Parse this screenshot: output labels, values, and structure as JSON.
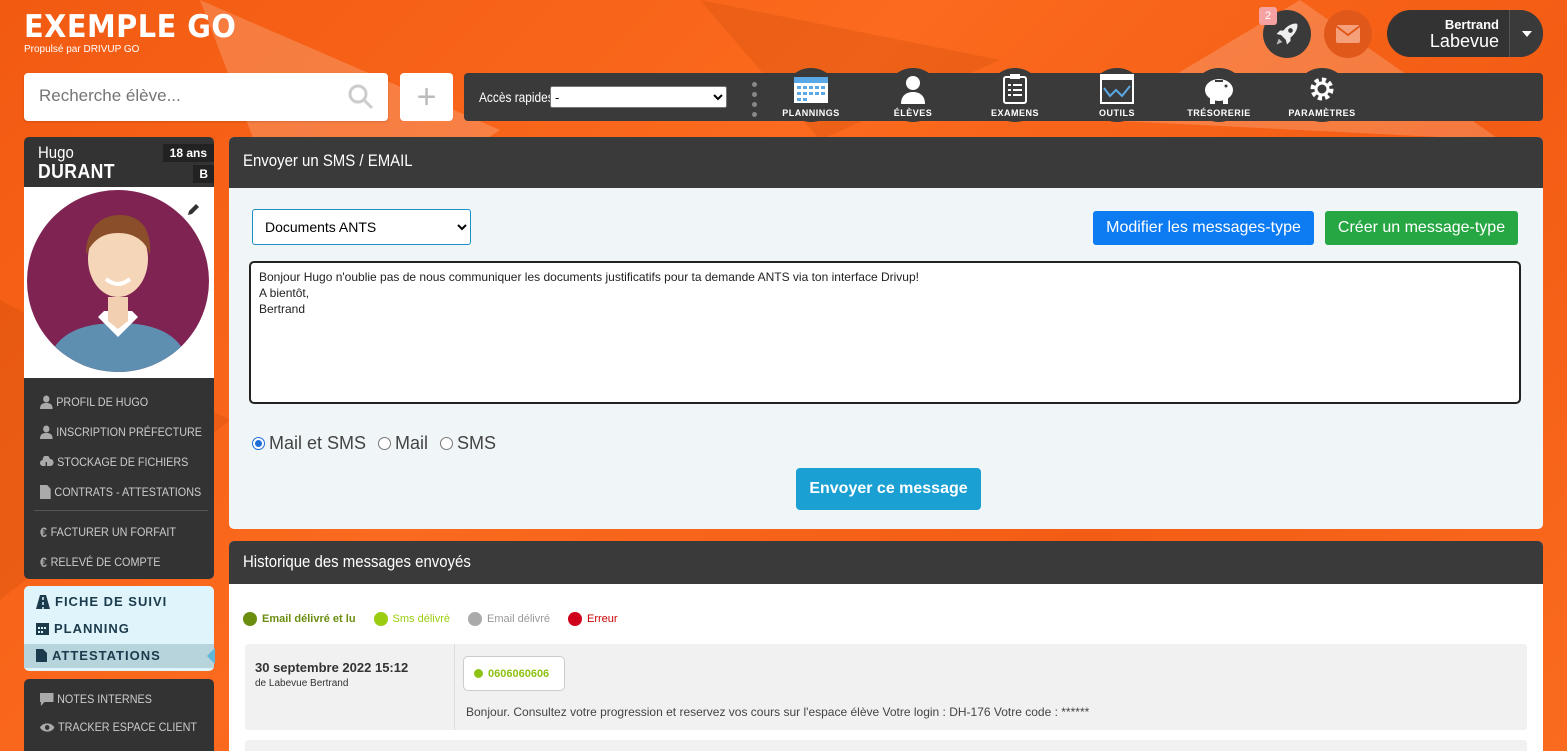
{
  "brand": {
    "title": "EXEMPLE GO",
    "subtitle": "Propulsé par DRIVUP GO"
  },
  "notifications": {
    "count": "2"
  },
  "user": {
    "first_name": "Bertrand",
    "last_name": "Labevue"
  },
  "search": {
    "placeholder": "Recherche élève..."
  },
  "quick_access": {
    "label": "Accès rapides",
    "selected": "-"
  },
  "nav": [
    {
      "label": "PLANNINGS",
      "icon": "calendar-icon"
    },
    {
      "label": "ÉLÈVES",
      "icon": "user-icon"
    },
    {
      "label": "EXAMENS",
      "icon": "clipboard-icon"
    },
    {
      "label": "OUTILS",
      "icon": "chart-icon"
    },
    {
      "label": "TRÉSORERIE",
      "icon": "piggy-bank-icon"
    },
    {
      "label": "PARAMÈTRES",
      "icon": "gear-icon"
    }
  ],
  "student": {
    "first_name": "Hugo",
    "last_name": "DURANT",
    "age": "18 ans",
    "category": "B"
  },
  "menu1": [
    {
      "label": "Profil de Hugo",
      "icon": "user-icon"
    },
    {
      "label": "Inscription préfecture",
      "icon": "user-icon"
    },
    {
      "label": "Stockage de fichiers",
      "icon": "cloud-icon"
    },
    {
      "label": "Contrats - Attestations",
      "icon": "file-icon"
    },
    {
      "label": "Facturer un forfait",
      "icon": "euro-icon"
    },
    {
      "label": "Relevé de compte",
      "icon": "euro-icon"
    }
  ],
  "menu2": [
    {
      "label": "Fiche de suivi",
      "icon": "road-icon"
    },
    {
      "label": "Planning",
      "icon": "calendar-icon"
    },
    {
      "label": "Attestations",
      "icon": "file-icon"
    }
  ],
  "menu3": [
    {
      "label": "Notes internes",
      "icon": "comment-icon"
    },
    {
      "label": "Tracker espace client",
      "icon": "eye-icon"
    }
  ],
  "compose": {
    "title": "Envoyer un SMS / EMAIL",
    "template_selected": "Documents ANTS",
    "edit_templates_label": "Modifier les messages-type",
    "create_template_label": "Créer un message-type",
    "message": "Bonjour Hugo n'oublie pas de nous communiquer les documents justificatifs pour ta demande ANTS via ton interface Drivup!\nA bientôt,\nBertrand",
    "channels": [
      {
        "label": "Mail et SMS",
        "checked": true
      },
      {
        "label": "Mail",
        "checked": false
      },
      {
        "label": "SMS",
        "checked": false
      }
    ],
    "send_label": "Envoyer ce message"
  },
  "history": {
    "title": "Historique des messages envoyés",
    "legend": [
      {
        "label": "Email délivré et lu",
        "color": "#6b8e10"
      },
      {
        "label": "Sms délivré",
        "color": "#9acd0f"
      },
      {
        "label": "Email délivré",
        "color": "#aaaaaa"
      },
      {
        "label": "Erreur",
        "color": "#d0021b"
      }
    ],
    "entries": [
      {
        "date": "30 septembre 2022 15:12",
        "author": "de Labevue Bertrand",
        "recipient": "0606060606",
        "text": "Bonjour. Consultez votre progression et reservez vos cours sur l'espace élève Votre login : DH-176 Votre code : ******"
      }
    ]
  }
}
